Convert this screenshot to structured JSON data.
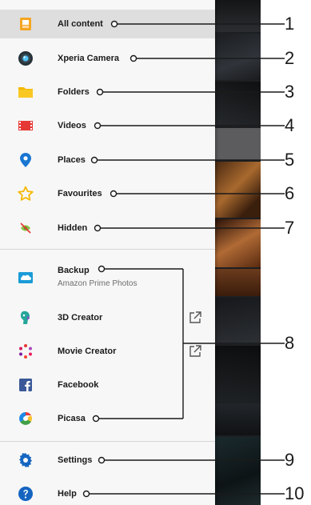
{
  "menu": {
    "items": [
      {
        "label": "All content",
        "icon": "all-content-icon",
        "callout": "1"
      },
      {
        "label": "Xperia Camera",
        "icon": "camera-icon",
        "callout": "2"
      },
      {
        "label": "Folders",
        "icon": "folder-icon",
        "callout": "3"
      },
      {
        "label": "Videos",
        "icon": "film-icon",
        "callout": "4"
      },
      {
        "label": "Places",
        "icon": "location-pin-icon",
        "callout": "5"
      },
      {
        "label": "Favourites",
        "icon": "star-icon",
        "callout": "6"
      },
      {
        "label": "Hidden",
        "icon": "hidden-icon",
        "callout": "7"
      }
    ],
    "extensions": [
      {
        "label": "Backup",
        "sublabel": "Amazon Prime Photos",
        "icon": "cloud-backup-icon"
      },
      {
        "label": "3D Creator",
        "icon": "3d-creator-icon",
        "external": true
      },
      {
        "label": "Movie Creator",
        "icon": "movie-creator-icon",
        "external": true
      },
      {
        "label": "Facebook",
        "icon": "facebook-icon"
      },
      {
        "label": "Picasa",
        "icon": "picasa-icon"
      }
    ],
    "extensions_callout": "8",
    "bottom": [
      {
        "label": "Settings",
        "icon": "gear-icon",
        "callout": "9"
      },
      {
        "label": "Help",
        "icon": "help-icon",
        "callout": "10"
      }
    ]
  },
  "colors": {
    "icon_orange": "#f5a623",
    "icon_red": "#e53935",
    "icon_blue": "#1565c0",
    "selected_bg": "#dedede",
    "drawer_bg": "#f7f7f7"
  }
}
